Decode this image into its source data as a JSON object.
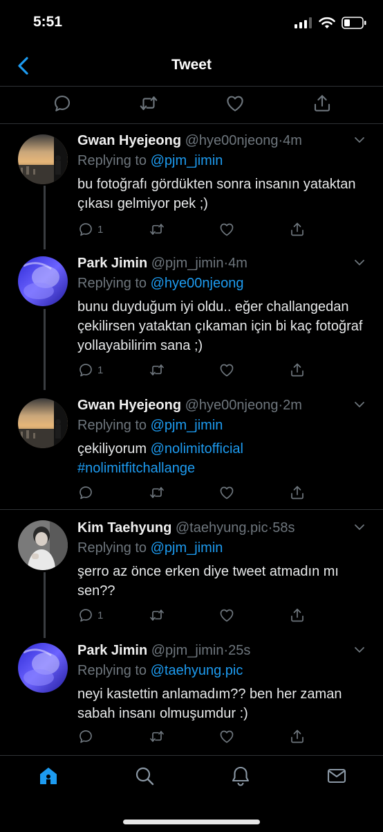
{
  "status": {
    "time": "5:51"
  },
  "header": {
    "title": "Tweet",
    "back_icon": "chevron-left-icon",
    "accent": "#1d9bf0"
  },
  "main_tweet_actions": [
    "reply-icon",
    "retweet-icon",
    "like-icon",
    "share-icon"
  ],
  "replies": [
    {
      "name": "Gwan Hyejeong",
      "handle": "@hye00njeong",
      "dot": "·",
      "time": "4m",
      "replying_label": "Replying to",
      "replying_to": "@pjm_jimin",
      "text": "bu fotoğrafı gördükten sonra insanın yataktan çıkası gelmiyor pek ;)",
      "reply_count": "1"
    },
    {
      "name": "Park Jimin",
      "handle": "@pjm_jimin",
      "dot": "·",
      "time": "4m",
      "replying_label": "Replying to",
      "replying_to": "@hye00njeong",
      "text": "bunu duyduğum iyi oldu.. eğer challangedan çekilirsen yataktan çıkaman için bi kaç fotoğraf yollayabilirim sana ;)",
      "reply_count": "1"
    },
    {
      "name": "Gwan Hyejeong",
      "handle": "@hye00njeong",
      "dot": "·",
      "time": "2m",
      "replying_label": "Replying to",
      "replying_to": "@pjm_jimin",
      "text_plain": "çekiliyorum ",
      "text_link1": "@nolimitofficial",
      "text_link2": "#nolimitfitchallange",
      "reply_count": ""
    },
    {
      "name": "Kim Taehyung",
      "handle": "@taehyung.pic",
      "dot": "·",
      "time": "58s",
      "replying_label": "Replying to",
      "replying_to": "@pjm_jimin",
      "text": "şerro az önce erken diye tweet atmadın mı sen??",
      "reply_count": "1"
    },
    {
      "name": "Park Jimin",
      "handle": "@pjm_jimin",
      "dot": "·",
      "time": "25s",
      "replying_label": "Replying to",
      "replying_to": "@taehyung.pic",
      "text": "neyi kastettin anlamadım?? ben her zaman sabah insanı olmuşumdur :)",
      "reply_count": ""
    }
  ],
  "tabbar": [
    "home-icon",
    "search-icon",
    "notifications-icon",
    "messages-icon"
  ]
}
